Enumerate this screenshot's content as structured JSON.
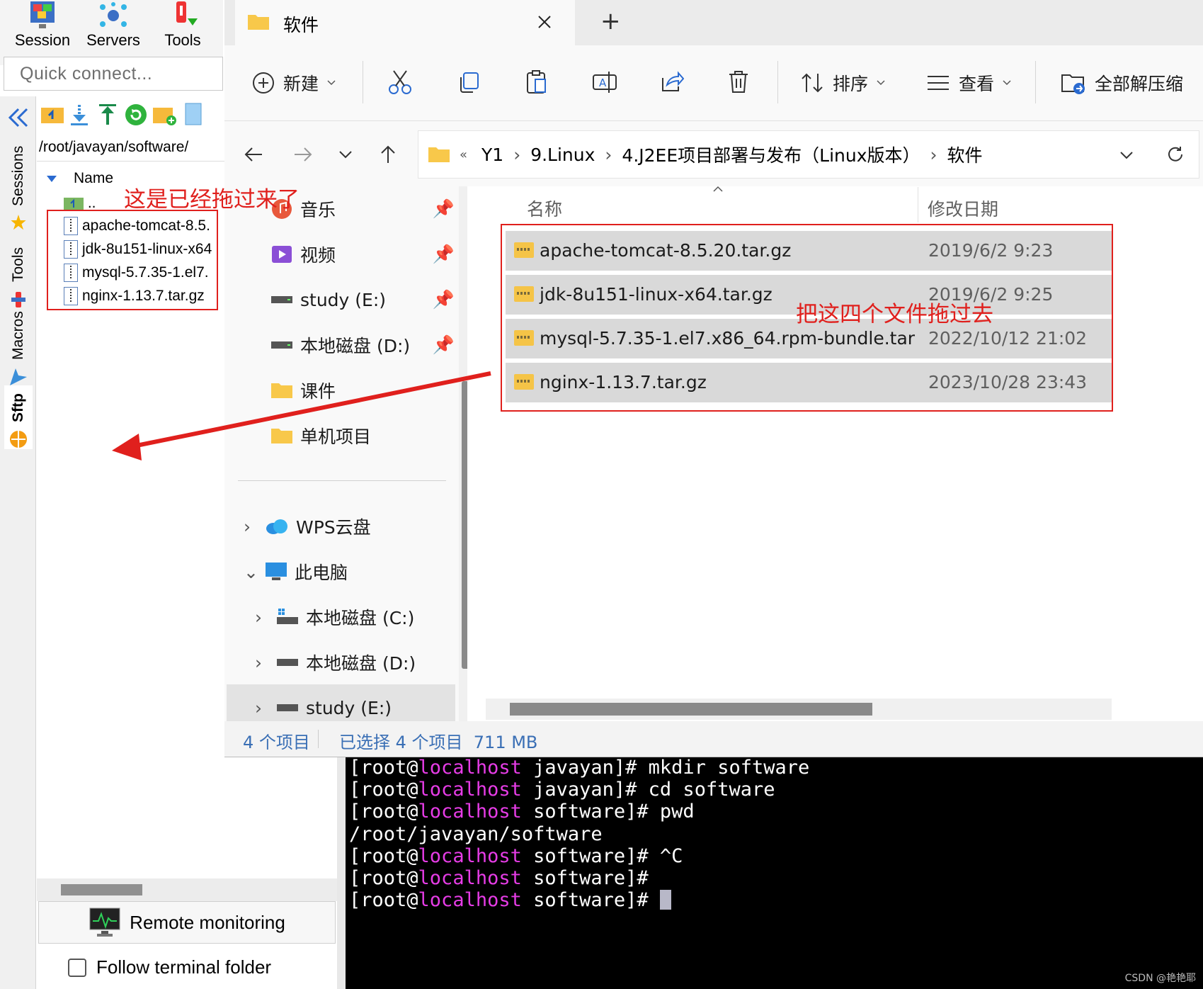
{
  "moba": {
    "toolbar": [
      {
        "label": "Session",
        "icon": "session-icon"
      },
      {
        "label": "Servers",
        "icon": "servers-icon"
      },
      {
        "label": "Tools",
        "icon": "tools-icon"
      }
    ],
    "quick_connect_placeholder": "Quick connect...",
    "side_tabs": [
      "Sessions",
      "Tools",
      "Macros",
      "Sftp"
    ],
    "sftp_path": "/root/javayan/software/",
    "col_name": "Name",
    "parent_dir": "..",
    "files": [
      "apache-tomcat-8.5.",
      "jdk-8u151-linux-x64",
      "mysql-5.7.35-1.el7.",
      "nginx-1.13.7.tar.gz"
    ],
    "remote_monitoring": "Remote monitoring",
    "follow_terminal": "Follow terminal folder"
  },
  "explorer": {
    "tab_title": "软件",
    "new_tab": "+",
    "cmd": {
      "new": "新建",
      "sort": "排序",
      "view": "查看",
      "extract": "全部解压缩"
    },
    "breadcrumb": [
      "Y1",
      "9.Linux",
      "4.J2EE项目部署与发布（Linux版本）",
      "软件"
    ],
    "breadcrumb_overflow": "«",
    "nav_quick": [
      {
        "label": "音乐",
        "icon": "music-icon",
        "pinned": true
      },
      {
        "label": "视频",
        "icon": "video-icon",
        "pinned": true
      },
      {
        "label": "study (E:)",
        "icon": "drive-icon",
        "pinned": true
      },
      {
        "label": "本地磁盘 (D:)",
        "icon": "drive-icon",
        "pinned": true
      },
      {
        "label": "课件",
        "icon": "folder-icon",
        "pinned": false
      },
      {
        "label": "单机项目",
        "icon": "folder-icon",
        "pinned": false
      }
    ],
    "nav_tree": [
      {
        "label": "WPS云盘",
        "icon": "cloud-icon"
      },
      {
        "label": "此电脑",
        "icon": "computer-icon"
      },
      {
        "label": "本地磁盘 (C:)",
        "icon": "drive-icon"
      },
      {
        "label": "本地磁盘 (D:)",
        "icon": "drive-icon"
      },
      {
        "label": "study (E:)",
        "icon": "drive-icon"
      }
    ],
    "col_name": "名称",
    "col_date": "修改日期",
    "files": [
      {
        "name": "apache-tomcat-8.5.20.tar.gz",
        "date": "2019/6/2 9:23"
      },
      {
        "name": "jdk-8u151-linux-x64.tar.gz",
        "date": "2019/6/2 9:25"
      },
      {
        "name": "mysql-5.7.35-1.el7.x86_64.rpm-bundle.tar",
        "date": "2022/10/12 21:02"
      },
      {
        "name": "nginx-1.13.7.tar.gz",
        "date": "2023/10/28 23:43"
      }
    ],
    "status": {
      "count": "4 个项目",
      "selected": "已选择 4 个项目  711 MB"
    }
  },
  "terminal": {
    "lines": [
      {
        "user": "[root@",
        "host": "localhost",
        "rest": " javayan]# mkdir software"
      },
      {
        "user": "[root@",
        "host": "localhost",
        "rest": " javayan]# cd software"
      },
      {
        "user": "[root@",
        "host": "localhost",
        "rest": " software]# pwd"
      },
      {
        "plain": "/root/javayan/software"
      },
      {
        "user": "[root@",
        "host": "localhost",
        "rest": " software]# ^C"
      },
      {
        "user": "[root@",
        "host": "localhost",
        "rest": " software]#"
      },
      {
        "user": "[root@",
        "host": "localhost",
        "rest": " software]# "
      }
    ]
  },
  "annotations": {
    "left": "这是已经拖过来了",
    "right": "把这四个文件拖过去",
    "color": "#e0201d"
  },
  "watermark": "CSDN @艳艳耶"
}
